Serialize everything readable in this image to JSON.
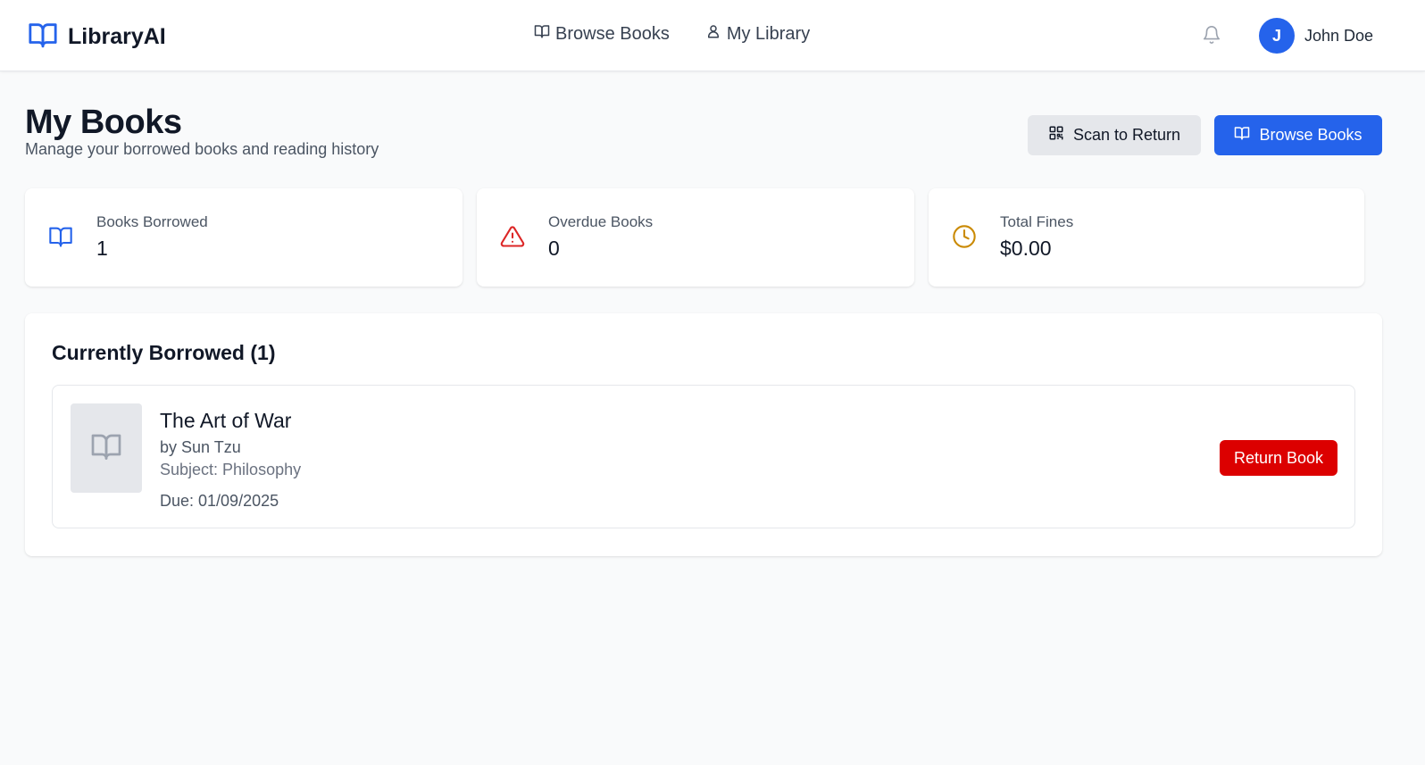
{
  "brand": {
    "name": "LibraryAI",
    "icon": "book-open-icon"
  },
  "nav": [
    {
      "label": "Browse Books",
      "icon": "book-open-icon"
    },
    {
      "label": "My Library",
      "icon": "user-icon"
    }
  ],
  "user": {
    "initial": "J",
    "name": "John Doe"
  },
  "page": {
    "title": "My Books",
    "subtitle": "Manage your borrowed books and reading history"
  },
  "actions": {
    "scan_label": "Scan to Return",
    "browse_label": "Browse Books"
  },
  "stats": [
    {
      "label": "Books Borrowed",
      "value": "1",
      "icon": "book-open-icon",
      "color": "#2563eb"
    },
    {
      "label": "Overdue Books",
      "value": "0",
      "icon": "alert-triangle-icon",
      "color": "#dc2626"
    },
    {
      "label": "Total Fines",
      "value": "$0.00",
      "icon": "clock-icon",
      "color": "#ca8a04"
    }
  ],
  "borrowed": {
    "title": "Currently Borrowed (1)",
    "books": [
      {
        "title": "The Art of War",
        "author": "by Sun Tzu",
        "subject": "Subject: Philosophy",
        "due": "Due: 01/09/2025",
        "action_label": "Return Book"
      }
    ]
  },
  "colors": {
    "accent": "#2563eb",
    "danger": "#dc0000",
    "background": "#f9fafb"
  }
}
